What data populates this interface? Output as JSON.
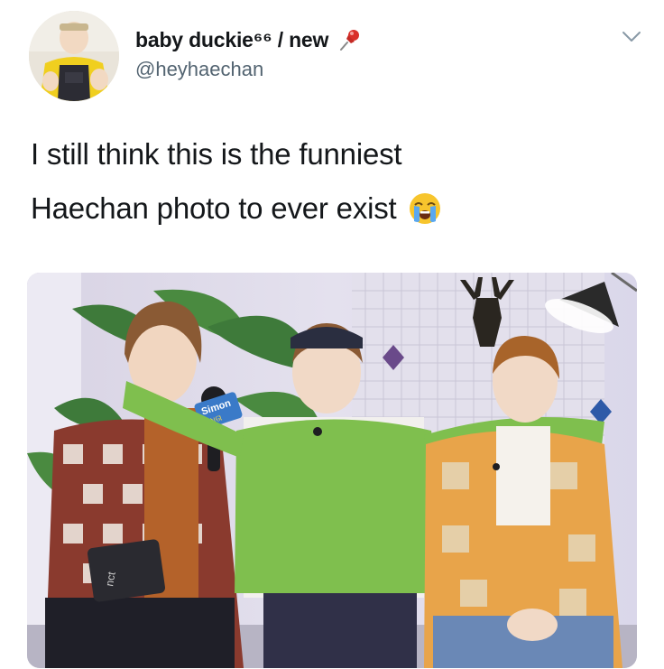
{
  "tweet": {
    "display_name": "baby duckie⁶⁶ / new",
    "handle": "@heyhaechan",
    "text_line_1": "I still think this is the funniest",
    "text_line_2": "Haechan photo to ever exist"
  },
  "media": {
    "mic_flag_text": "Simon",
    "mic_flag_subtext": "ଧତା",
    "folder_text": "nct"
  },
  "icons": {
    "pin": "pushpin-icon",
    "menu": "chevron-down-icon",
    "emoji": "loudly-crying-face-icon"
  },
  "colors": {
    "text": "#14171a",
    "secondary_text": "#536471",
    "pin_red": "#d9302a"
  }
}
